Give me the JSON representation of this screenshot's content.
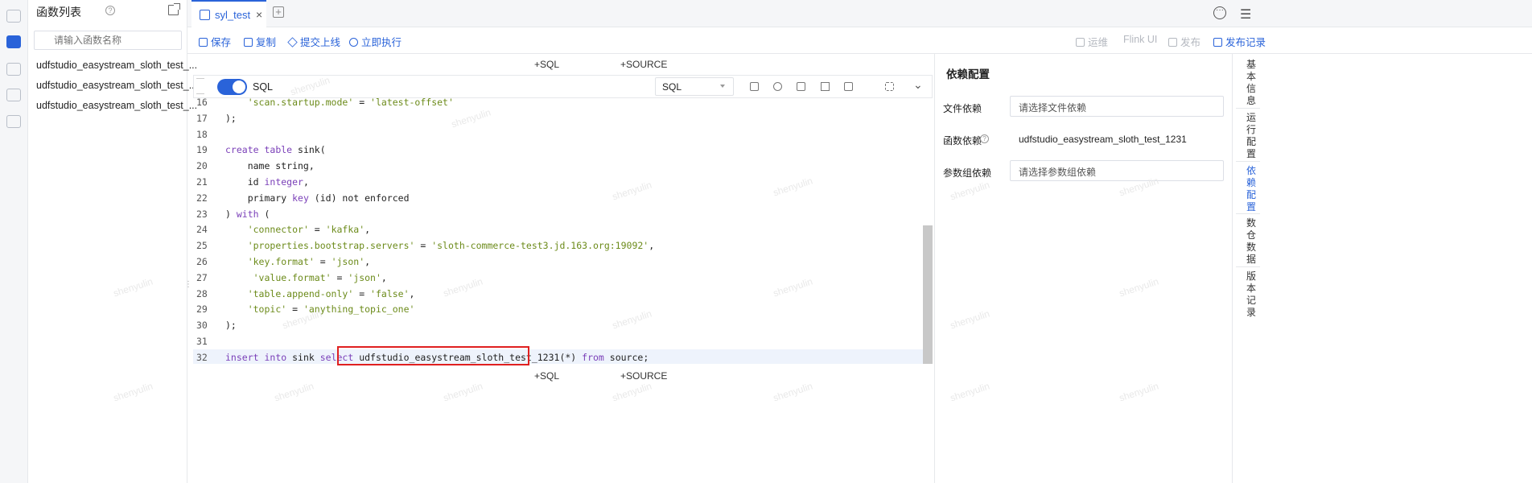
{
  "function_panel": {
    "title": "函数列表",
    "search_placeholder": "请输入函数名称",
    "items": [
      "udfstudio_easystream_sloth_test_...",
      "udfstudio_easystream_sloth_test_...",
      "udfstudio_easystream_sloth_test_..."
    ]
  },
  "tab": {
    "label": "syl_test",
    "close": "×",
    "add": "+"
  },
  "toolbar": {
    "save": "保存",
    "copy": "复制",
    "submit": "提交上线",
    "run": "立即执行",
    "ops": "运维",
    "flink_ui": "Flink UI",
    "publish": "发布",
    "publish_log": "发布记录"
  },
  "editor": {
    "add_sql": "+SQL",
    "add_source": "+SOURCE",
    "toggle_label": "SQL",
    "toggle_on": true,
    "language": "SQL",
    "lines": [
      {
        "n": "16",
        "text": "    'scan.startup.mode' = 'latest-offset'"
      },
      {
        "n": "17",
        "text": ");"
      },
      {
        "n": "18",
        "text": ""
      },
      {
        "n": "19",
        "text": "create table sink("
      },
      {
        "n": "20",
        "text": "    name string,"
      },
      {
        "n": "21",
        "text": "    id integer,"
      },
      {
        "n": "22",
        "text": "    primary key (id) not enforced"
      },
      {
        "n": "23",
        "text": ") with ("
      },
      {
        "n": "24",
        "text": "    'connector' = 'kafka',"
      },
      {
        "n": "25",
        "text": "    'properties.bootstrap.servers' = 'sloth-commerce-test3.jd.163.org:19092',"
      },
      {
        "n": "26",
        "text": "    'key.format' = 'json',"
      },
      {
        "n": "27",
        "text": "     'value.format' = 'json',"
      },
      {
        "n": "28",
        "text": "    'table.append-only' = 'false',"
      },
      {
        "n": "29",
        "text": "    'topic' = 'anything_topic_one'"
      },
      {
        "n": "30",
        "text": ");"
      },
      {
        "n": "31",
        "text": ""
      },
      {
        "n": "32",
        "text": "insert into sink select udfstudio_easystream_sloth_test_1231(*) from source;"
      }
    ]
  },
  "deps": {
    "title": "依赖配置",
    "file_label": "文件依赖",
    "file_placeholder": "请选择文件依赖",
    "func_label": "函数依赖",
    "func_value": "udfstudio_easystream_sloth_test_1231",
    "param_label": "参数组依赖",
    "param_placeholder": "请选择参数组依赖"
  },
  "side_tabs": [
    "基本信息",
    "运行配置",
    "依赖配置",
    "数仓数据",
    "版本记录"
  ],
  "watermark": "shenyulin",
  "colors": {
    "accent": "#2a63d9",
    "highlight": "#e02020",
    "keyword": "#7a3fb8",
    "string": "#6c8b1a"
  }
}
